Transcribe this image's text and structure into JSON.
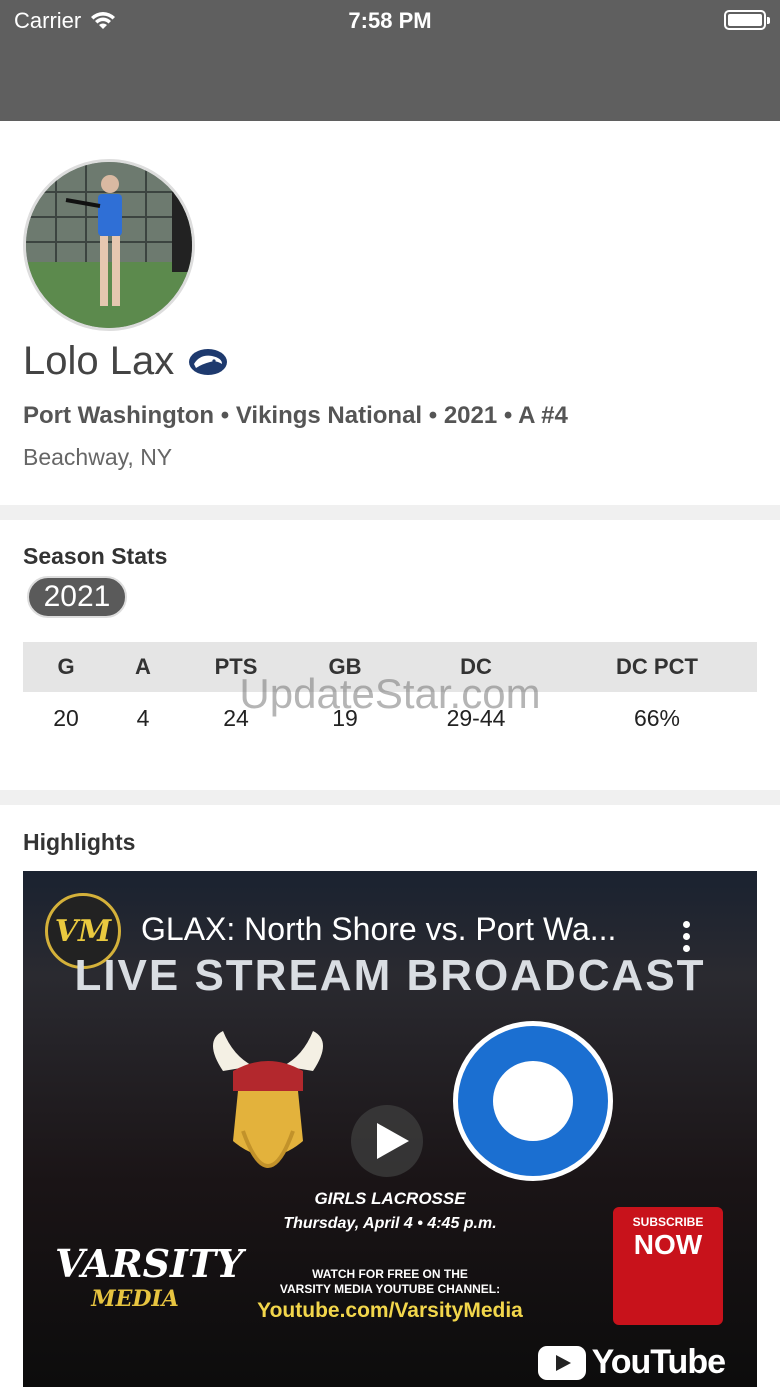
{
  "status_bar": {
    "carrier": "Carrier",
    "time": "7:58 PM"
  },
  "profile": {
    "name": "Lolo Lax",
    "team_line": "Port Washington • Vikings National • 2021 • A #4",
    "location": "Beachway, NY",
    "college_logo_icon": "penn-state-lion-icon"
  },
  "stats": {
    "title": "Season Stats",
    "season": "2021",
    "columns": [
      "G",
      "A",
      "PTS",
      "GB",
      "DC",
      "DC PCT"
    ],
    "row": [
      "20",
      "4",
      "24",
      "19",
      "29-44",
      "66%"
    ],
    "watermark": "UpdateStar.com"
  },
  "highlights": {
    "title": "Highlights",
    "video": {
      "channel_logo": "VM",
      "title": "GLAX: North Shore vs. Port Wa...",
      "banner": "LIVE STREAM BROADCAST",
      "event_line1": "GIRLS LACROSSE",
      "event_line2": "Thursday, April 4 • 4:45 p.m.",
      "watch_line1": "WATCH FOR FREE ON THE",
      "watch_line2": "VARSITY MEDIA YOUTUBE CHANNEL:",
      "url": "Youtube.com/VarsityMedia",
      "varsity_top": "VARSITY",
      "varsity_bottom": "MEDIA",
      "subscribe_top": "SUBSCRIBE",
      "subscribe_bottom": "NOW",
      "youtube_label": "YouTube"
    }
  },
  "colors": {
    "status_bar": "#5f5f5f",
    "chip": "#5a5a5a",
    "table_header": "#e5e5e5",
    "penn_state_blue": "#1e3a6e"
  }
}
